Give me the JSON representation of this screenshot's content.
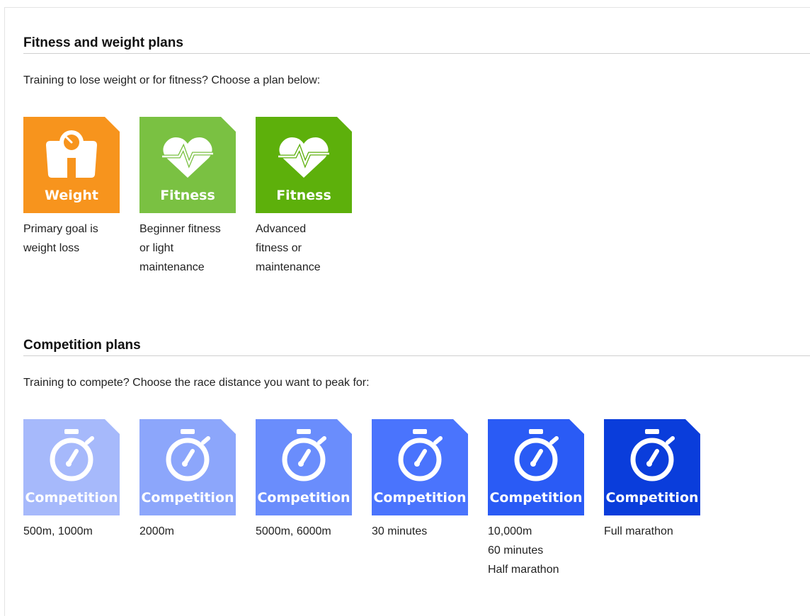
{
  "fitness_section": {
    "title": "Fitness and weight plans",
    "intro": "Training to lose weight or for fitness? Choose a plan below:",
    "plans": [
      {
        "tile_label": "Weight",
        "description": [
          "Primary goal is",
          "weight loss"
        ],
        "color": "#f7941d",
        "icon": "scale-icon"
      },
      {
        "tile_label": "Fitness",
        "description": [
          "Beginner fitness",
          "or light",
          "maintenance"
        ],
        "color": "#7ac142",
        "icon": "heart-pulse-icon"
      },
      {
        "tile_label": "Fitness",
        "description": [
          "Advanced",
          "fitness or",
          "maintenance"
        ],
        "color": "#5db00b",
        "icon": "heart-pulse-icon"
      }
    ]
  },
  "competition_section": {
    "title": "Competition plans",
    "intro": "Training to compete? Choose the race distance you want to peak for:",
    "plans": [
      {
        "tile_label": "Competition",
        "description": [
          "500m, 1000m"
        ],
        "color": "#a6b9fb",
        "icon": "stopwatch-icon"
      },
      {
        "tile_label": "Competition",
        "description": [
          "2000m"
        ],
        "color": "#8ca6fb",
        "icon": "stopwatch-icon"
      },
      {
        "tile_label": "Competition",
        "description": [
          "5000m, 6000m"
        ],
        "color": "#6a8dfc",
        "icon": "stopwatch-icon"
      },
      {
        "tile_label": "Competition",
        "description": [
          "30 minutes"
        ],
        "color": "#4a74fd",
        "icon": "stopwatch-icon"
      },
      {
        "tile_label": "Competition",
        "description": [
          "10,000m",
          "60 minutes",
          "Half marathon"
        ],
        "color": "#2a5bf5",
        "icon": "stopwatch-icon"
      },
      {
        "tile_label": "Competition",
        "description": [
          "Full marathon"
        ],
        "color": "#0a3ddb",
        "icon": "stopwatch-icon"
      }
    ]
  }
}
